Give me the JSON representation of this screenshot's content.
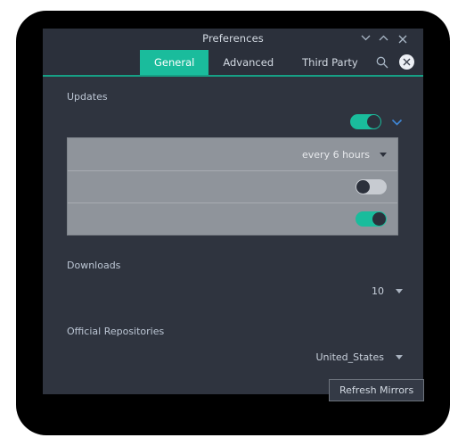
{
  "window": {
    "title": "Preferences",
    "controls": {
      "minimize": "chevron-down",
      "maximize": "chevron-up",
      "close": "close-x"
    }
  },
  "tabs": [
    {
      "label": "General",
      "active": true
    },
    {
      "label": "Advanced",
      "active": false
    },
    {
      "label": "Third Party",
      "active": false
    }
  ],
  "toolbar": {
    "search_icon": "search-icon",
    "close_icon": "close-circle-icon"
  },
  "sections": {
    "updates": {
      "label": "Updates",
      "master_toggle": "on",
      "expander": "chevron-down",
      "rows": [
        {
          "type": "dropdown",
          "value": "every 6 hours"
        },
        {
          "type": "toggle",
          "state": "off"
        },
        {
          "type": "toggle",
          "state": "on"
        }
      ]
    },
    "downloads": {
      "label": "Downloads",
      "value": "10"
    },
    "repositories": {
      "label": "Official Repositories",
      "value": "United_States",
      "refresh_button": "Refresh Mirrors"
    }
  },
  "colors": {
    "accent": "#1abc9c",
    "window_bg": "#2f343f",
    "titlebar_bg": "#2b303b",
    "panel_gray": "#8f949b",
    "text": "#d3dae3",
    "chevron_blue": "#3f87d6"
  }
}
